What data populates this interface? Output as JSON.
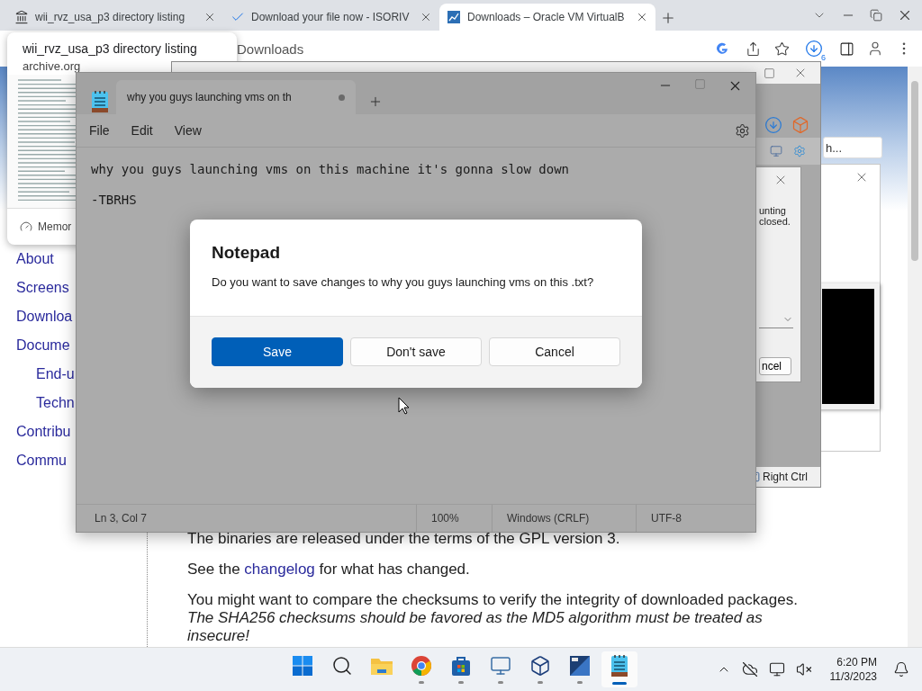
{
  "browser": {
    "tabs": [
      {
        "title": "wii_rvz_usa_p3 directory listing",
        "selected": false
      },
      {
        "title": "Download your file now - ISORIV",
        "selected": false
      },
      {
        "title": "Downloads – Oracle VM VirtualB",
        "selected": true
      }
    ],
    "address": "Downloads",
    "download_count": "6",
    "hover_card": {
      "title": "wii_rvz_usa_p3 directory listing",
      "domain": "archive.org",
      "footer": "Memor"
    },
    "nav": [
      {
        "label": "About"
      },
      {
        "label": "Screens"
      },
      {
        "label": "Downloa"
      },
      {
        "label": "Docume",
        "children": [
          {
            "label": "End-u"
          },
          {
            "label": "Techn"
          }
        ]
      },
      {
        "label": "Contribu"
      },
      {
        "label": "Commu"
      }
    ],
    "license": "The binaries are released under the terms of the GPL version 3.",
    "changelog": {
      "before": "See the ",
      "link": "changelog",
      "after": " for what has changed."
    },
    "checksums": {
      "text": "You might want to compare the checksums to verify the integrity of downloaded packages.",
      "note": "The SHA256 checksums should be favored as the MD5 algorithm must be treated as insecure!"
    }
  },
  "virtualbox": {
    "search": "h...",
    "dialog": {
      "lines": [
        "unting",
        "closed."
      ],
      "button": "ncel"
    },
    "status_key": "Right Ctrl"
  },
  "notepad": {
    "tab_title": "why you guys launching vms on th",
    "modified": true,
    "menu": [
      "File",
      "Edit",
      "View"
    ],
    "lines": [
      "why you guys launching vms on this machine it's gonna slow down",
      "-TBRHS"
    ],
    "status": {
      "position": "Ln 3, Col 7",
      "zoom": "100%",
      "line_ending": "Windows (CRLF)",
      "encoding": "UTF-8"
    }
  },
  "dialog": {
    "title": "Notepad",
    "message": "Do you want to save changes to why you guys launching vms on this .txt?",
    "buttons": [
      {
        "label": "Save",
        "primary": true
      },
      {
        "label": "Don't save",
        "primary": false
      },
      {
        "label": "Cancel",
        "primary": false
      }
    ]
  },
  "taskbar": {
    "apps": [
      {
        "kind": "start",
        "running": false,
        "selected": false
      },
      {
        "kind": "search",
        "running": false,
        "selected": false
      },
      {
        "kind": "files",
        "running": false,
        "selected": false
      },
      {
        "kind": "chrome",
        "running": true,
        "selected": false
      },
      {
        "kind": "store",
        "running": true,
        "selected": false
      },
      {
        "kind": "network",
        "running": true,
        "selected": false
      },
      {
        "kind": "virtualbox",
        "running": true,
        "selected": false
      },
      {
        "kind": "xp",
        "running": true,
        "selected": false
      },
      {
        "kind": "notepad",
        "running": true,
        "selected": true
      }
    ],
    "time": "6:20 PM",
    "date": "11/3/2023"
  }
}
